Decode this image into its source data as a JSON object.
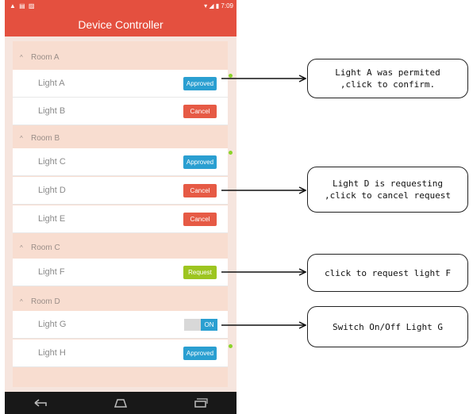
{
  "status_bar": {
    "left_icons": "▲ ▤ ▨",
    "time": "7:09"
  },
  "app": {
    "title": "Device Controller"
  },
  "rooms": [
    {
      "name": "Room A",
      "devices": [
        {
          "name": "Light A",
          "control": "Approved"
        },
        {
          "name": "Light B",
          "control": "Cancel"
        }
      ]
    },
    {
      "name": "Room B",
      "devices": [
        {
          "name": "Light C",
          "control": "Approved"
        },
        {
          "name": "Light D",
          "control": "Cancel"
        },
        {
          "name": "Light E",
          "control": "Cancel"
        }
      ]
    },
    {
      "name": "Room C",
      "devices": [
        {
          "name": "Light F",
          "control": "Request"
        }
      ]
    },
    {
      "name": "Room D",
      "devices": [
        {
          "name": "Light G",
          "control": "ON"
        },
        {
          "name": "Light H",
          "control": "Approved"
        }
      ]
    }
  ],
  "annotations": {
    "a": [
      "Light  A  was  permited",
      ",click  to  confirm."
    ],
    "d": [
      "Light  D  is  requesting",
      ",click  to  cancel  request"
    ],
    "f": "click  to  request  light  F",
    "g": "Switch  On/Off  Light  G"
  },
  "colors": {
    "app_bar": "#e4503f",
    "approved": "#2a9fd1",
    "cancel": "#e65a45",
    "request": "#9dc520",
    "indicator": "#8bd42a"
  },
  "icons": {
    "nav": [
      "back-icon",
      "home-icon",
      "recents-icon"
    ],
    "status": [
      "wifi-icon",
      "signal-icon",
      "battery-icon"
    ]
  }
}
